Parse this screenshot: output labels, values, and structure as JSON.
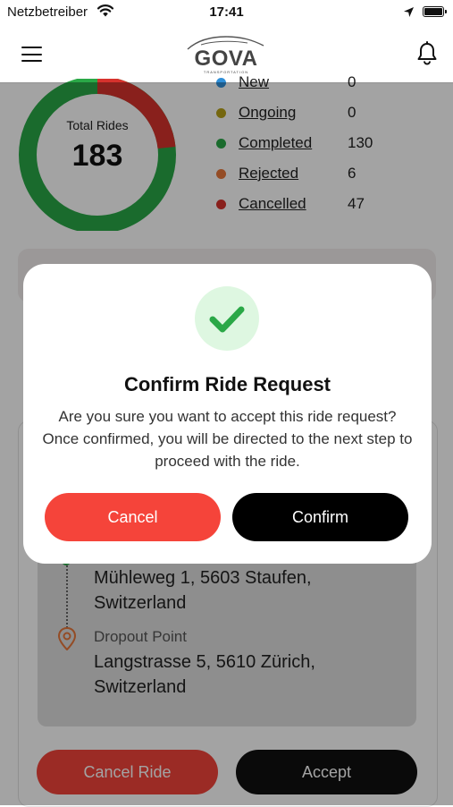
{
  "status_bar": {
    "carrier": "Netzbetreiber",
    "time": "17:41"
  },
  "header": {
    "logo_text": "GOVA",
    "logo_subtext": "TRANSPORTATION"
  },
  "stats": {
    "total_label": "Total Rides",
    "total_value": "183",
    "items": [
      {
        "label": "New",
        "count": "0",
        "color": "#2f8fd8"
      },
      {
        "label": "Ongoing",
        "count": "0",
        "color": "#b8a218"
      },
      {
        "label": "Completed",
        "count": "130",
        "color": "#2aa847"
      },
      {
        "label": "Rejected",
        "count": "6",
        "color": "#e8773a"
      },
      {
        "label": "Cancelled",
        "count": "47",
        "color": "#d7322d"
      }
    ],
    "colors": {
      "completed": "#2aa847",
      "cancelled": "#d7322d"
    }
  },
  "ride": {
    "pickup_address": "Mühleweg 1, 5603 Staufen, Switzerland",
    "dropout_label": "Dropout Point",
    "dropout_address": "Langstrasse 5, 5610 Zürich, Switzerland",
    "cancel_label": "Cancel Ride",
    "accept_label": "Accept"
  },
  "modal": {
    "title": "Confirm Ride Request",
    "body": "Are you sure you want to accept this ride request? Once confirmed, you will be directed to the next step to proceed with the ride.",
    "cancel_label": "Cancel",
    "confirm_label": "Confirm",
    "icon": "check-icon",
    "accent_color": "#2aa847"
  }
}
